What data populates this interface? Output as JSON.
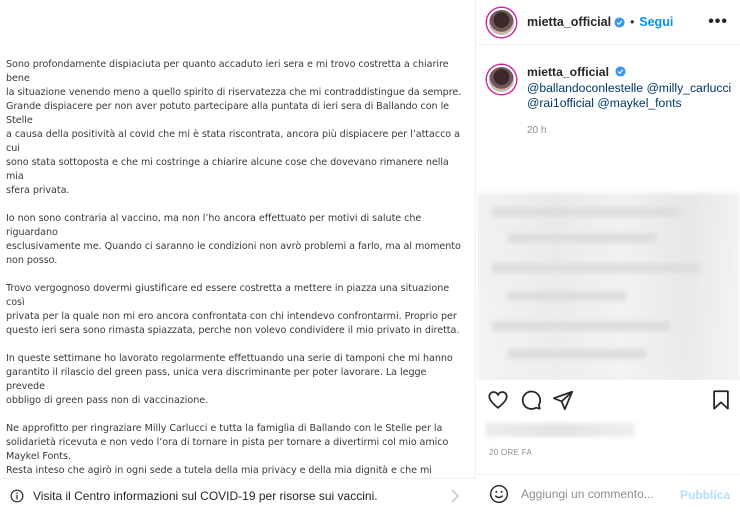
{
  "post": {
    "paragraphs": [
      "Sono profondamente dispiaciuta per quanto accaduto ieri sera e mi trovo costretta a chiarire bene\nla situazione venendo meno a quello spirito di riservatezza che mi contraddistingue da sempre.\nGrande dispiacere per non aver potuto partecipare alla puntata di ieri sera di Ballando con le Stelle\na causa della positività al covid che mi è stata riscontrata, ancora più dispiacere per l’attacco a cui\nsono stata sottoposta e che mi costringe a chiarire alcune cose che dovevano rimanere nella mia\nsfera privata.",
      "Io non sono contraria al vaccino, ma non l’ho ancora effettuato per motivi di salute che riguardano\nesclusivamente me. Quando ci saranno le condizioni non avrò problemi a farlo, ma al momento\nnon posso.",
      "Trovo vergognoso dovermi giustificare ed essere costretta a mettere in piazza una situazione così\nprivata per la quale non mi ero ancora confrontata con chi intendevo confrontarmi. Proprio per\nquesto ieri sera sono rimasta spiazzata, perche non volevo condividere il mio privato in diretta.",
      "In queste settimane ho lavorato regolarmente effettuando una serie di tamponi che mi hanno\ngarantito il rilascio del green pass, unica vera discriminante per poter lavorare. La legge prevede\nobbligo di green pass non di vaccinazione.",
      "Ne approfitto per ringraziare Milly Carlucci e tutta la famiglia di Ballando con le Stelle per la\nsolidarietà ricevuta e non vedo l’ora di tornare  in pista  per tornare a divertirmi col mio amico\nMaykel Fonts.\nResta inteso che agirò in ogni sede a tutela della mia privacy e della mia dignità e che mi aspetto\ndelle scuse da chi mi ha messo inopinatamente alla gogna."
    ],
    "covid_notice": "Visita il Centro informazioni sul COVID-19 per risorse sui vaccini."
  },
  "header": {
    "username": "mietta_official",
    "separator": "•",
    "follow_label": "Segui",
    "more_label": "•••"
  },
  "caption": {
    "username": "mietta_official",
    "mentions": [
      "@ballandoconlestelle",
      "@milly_carlucci",
      "@rai1official",
      "@maykel_fonts"
    ],
    "time": "20 h"
  },
  "footer": {
    "date": "20 ORE FA",
    "comment_placeholder": "Aggiungi un commento...",
    "publish_label": "Pubblica"
  },
  "icons": {
    "verified": "verified-badge-icon",
    "like": "heart-icon",
    "comment": "comment-bubble-icon",
    "share": "paper-plane-icon",
    "save": "bookmark-icon",
    "emoji": "smiley-icon",
    "info": "info-circle-icon",
    "next": "chevron-right-icon"
  },
  "colors": {
    "accent": "#0095f6",
    "verified": "#3897f0",
    "mention": "#00376b",
    "muted": "#8e8e8e",
    "publish_disabled": "#b2dffc"
  }
}
